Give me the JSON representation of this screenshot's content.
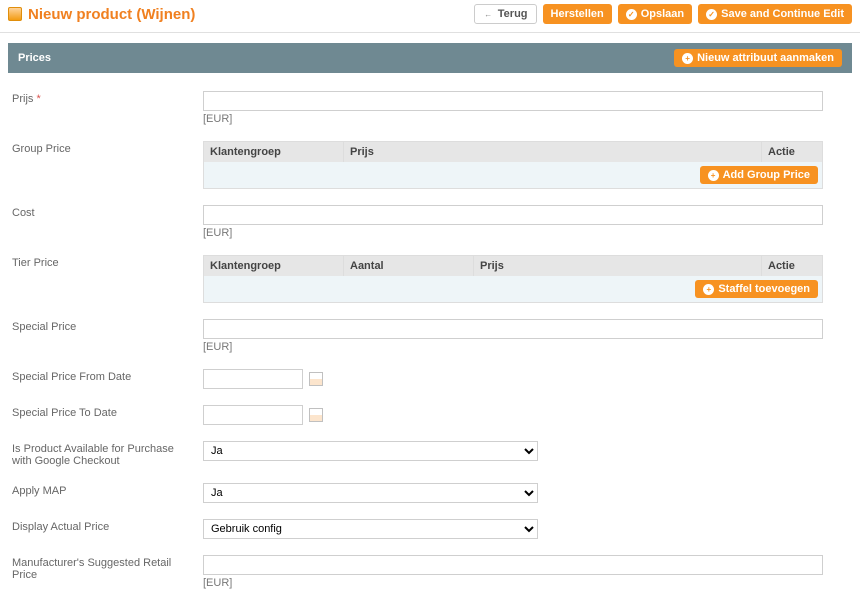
{
  "header": {
    "title": "Nieuw product (Wijnen)",
    "buttons": {
      "back": "Terug",
      "reset": "Herstellen",
      "save": "Opslaan",
      "save_continue": "Save and Continue Edit"
    }
  },
  "section": {
    "title": "Prices",
    "new_attr": "Nieuw attribuut aanmaken"
  },
  "labels": {
    "price": "Prijs",
    "group_price": "Group Price",
    "cost": "Cost",
    "tier_price": "Tier Price",
    "special_price": "Special Price",
    "special_from": "Special Price From Date",
    "special_to": "Special Price To Date",
    "google": "Is Product Available for Purchase with Google Checkout",
    "apply_map": "Apply MAP",
    "display_actual": "Display Actual Price",
    "msrp": "Manufacturer's Suggested Retail Price"
  },
  "hints": {
    "eur": "[EUR]"
  },
  "grid": {
    "klantengroep": "Klantengroep",
    "aantal": "Aantal",
    "prijs": "Prijs",
    "actie": "Actie",
    "add_group": "Add Group Price",
    "add_tier": "Staffel toevoegen"
  },
  "selects": {
    "ja": "Ja",
    "gebruik_config": "Gebruik config"
  }
}
